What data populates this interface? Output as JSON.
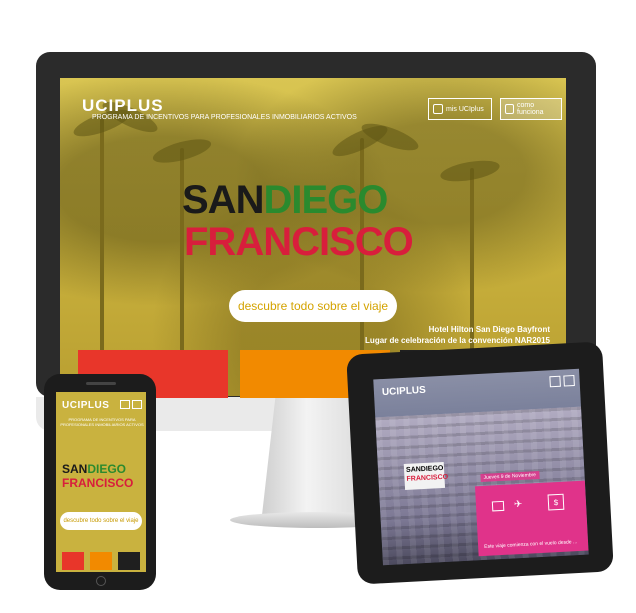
{
  "brand": {
    "logo": "UCIPLUS"
  },
  "desktop": {
    "tagline": "PROGRAMA DE INCENTIVOS PARA PROFESIONALES INMOBILIARIOS ACTIVOS",
    "nav": {
      "mis_label": "mis UCIplus",
      "como_label": "como funciona"
    },
    "title": {
      "word_san": "SAN",
      "word_diego": "DIEGO",
      "word_go": "",
      "line2": "FRANCISCO"
    },
    "cta_label": "descubre todo sobre el viaje",
    "location_line1": "Hotel Hilton San Diego Bayfront",
    "location_line2": "Lugar de celebración de la convención NAR2015",
    "tile_colors": [
      "#e8362a",
      "#f28a00",
      "#1f1f1f"
    ]
  },
  "phone": {
    "logo": "UCIPLUS",
    "tagline": "PROGRAMA DE INCENTIVOS PARA PROFESIONALES INMOBILIARIOS ACTIVOS",
    "title_line1_a": "SAN",
    "title_line1_b": "DIEGO",
    "title_line2": "FRANCISCO",
    "cta_label": "descubre todo sobre el viaje"
  },
  "tablet": {
    "logo": "UCIPLUS",
    "badge_line1": "SANDIEGO",
    "badge_line2": "FRANCISCO",
    "date_label": "Jueves 9 de Noviembre",
    "caption": "Este viaje comienza con el vuelo desde ...",
    "currency_icon": "$"
  },
  "colors": {
    "accent_yellow": "#c9b23f",
    "red": "#d81e3c",
    "green": "#2a8a2e",
    "pink": "#e0338a"
  }
}
